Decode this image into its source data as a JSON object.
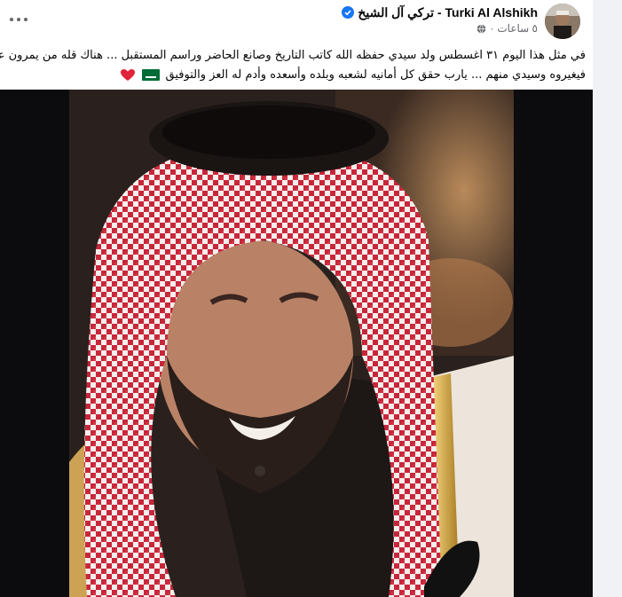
{
  "post": {
    "author": "Turki Al Alshikh - تركي آل الشيخ",
    "verified": true,
    "timestamp": "٥ ساعات",
    "audience_icon": "globe-icon",
    "more_icon": "more-options-icon",
    "text_line1": "في مثل هذا اليوم ٣١ اغسطس ولد سيدي حفظه الله كاتب التاريخ وصانع الحاضر وراسم المستقبل ... هناك قله من يمرون على العالم",
    "text_line2": "فيغيروه وسيدي منهم ... يارب حقق كل أمانيه لشعبه وبلده وأسعده وأدم له العز والتوفيق",
    "emojis": [
      "saudi-flag-emoji",
      "red-heart-emoji"
    ],
    "photo": "portrait-photo"
  },
  "colors": {
    "name": "#050505",
    "meta": "#65676b",
    "verified": "#1877f2",
    "page_bg": "#f0f2f5",
    "card_bg": "#ffffff",
    "photo_bg": "#0c0b0e"
  }
}
